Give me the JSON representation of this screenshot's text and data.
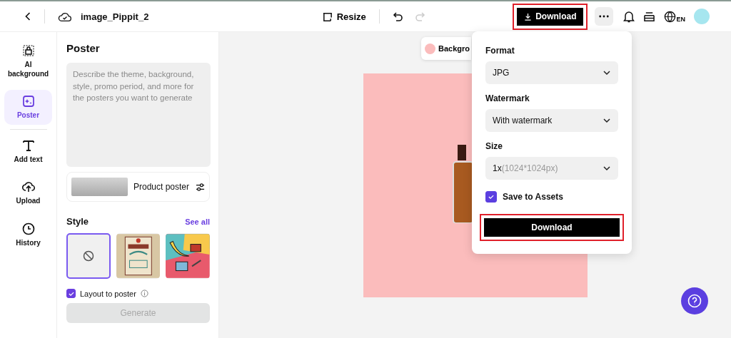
{
  "topbar": {
    "file_name": "image_Pippit_2",
    "resize": "Resize",
    "undo": {
      "disabled": false
    },
    "redo": {
      "disabled": true
    },
    "download": {
      "label": "Download",
      "highlighted": true
    },
    "language": "EN"
  },
  "nav": [
    {
      "kind": "ai-background",
      "label": "AI background",
      "selected": false
    },
    {
      "kind": "poster",
      "label": "Poster",
      "selected": true
    },
    {
      "kind": "text",
      "label": "Add text",
      "selected": false
    },
    {
      "kind": "upload",
      "label": "Upload",
      "selected": false
    },
    {
      "kind": "history",
      "label": "History",
      "selected": false
    }
  ],
  "panel": {
    "title": "Poster",
    "prompt_placeholder": "Describe the theme, background, style, promo period, and more for the posters you want to generate",
    "template": "Product poster",
    "style_heading": "Style",
    "see_all": "See all",
    "styles": [
      {
        "kind": "auto",
        "selected": true
      },
      {
        "kind": "retro",
        "selected": false
      },
      {
        "kind": "pop-art",
        "selected": false
      }
    ],
    "layout_checkbox": {
      "label": "Layout to poster",
      "checked": true
    },
    "generate": {
      "label": "Generate",
      "disabled": true
    }
  },
  "canvas": {
    "background_chip": {
      "label": "Backgro",
      "color": "#fbbcbc"
    }
  },
  "popup": {
    "fields": [
      {
        "label": "Format",
        "value": "JPG"
      },
      {
        "label": "Watermark",
        "value": "With watermark"
      },
      {
        "label": "Size",
        "value": "1x",
        "detail": "(1024*1024px)"
      }
    ],
    "save_checkbox": {
      "label": "Save to Assets",
      "checked": true
    },
    "download": {
      "label": "Download",
      "highlighted": true
    }
  }
}
